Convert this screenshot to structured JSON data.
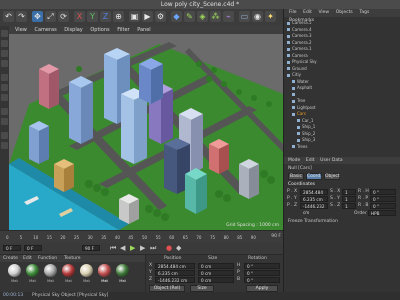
{
  "window": {
    "title": "Low poly city_Scene.c4d *"
  },
  "toolbar": {
    "buttons": [
      "undo-icon",
      "redo-icon",
      "move-icon",
      "scale-icon",
      "rotate-icon",
      "x-axis",
      "y-axis",
      "z-axis",
      "world-icon",
      "render-icon",
      "render-view-icon",
      "render-settings-icon",
      "cube-icon",
      "pen-icon",
      "subdivision-icon",
      "array-icon",
      "deformer-icon",
      "floor-icon",
      "camera-icon",
      "light-icon"
    ],
    "axis_labels": {
      "x": "X",
      "y": "Y",
      "z": "Z"
    }
  },
  "viewport": {
    "menu": [
      "View",
      "Cameras",
      "Display",
      "Options",
      "Filter",
      "Panel"
    ],
    "grid_spacing": "Grid Spacing : 1000 cm"
  },
  "timeline": {
    "ticks": [
      "0",
      "5",
      "10",
      "15",
      "20",
      "25",
      "30",
      "35",
      "40",
      "45",
      "50",
      "55",
      "60",
      "65",
      "70",
      "75",
      "80",
      "85",
      "90"
    ],
    "frame_start": "0 F",
    "frame_end": "90 F",
    "current_frame": "0 F"
  },
  "materials": {
    "menu": [
      "Create",
      "Edit",
      "Function",
      "Texture"
    ],
    "items": [
      {
        "label": "Mat",
        "color": "#cfcfcf"
      },
      {
        "label": "Mat",
        "color": "#3f8d3a"
      },
      {
        "label": "Mat",
        "color": "#a8a8a8"
      },
      {
        "label": "Mat",
        "color": "#b83a3a"
      },
      {
        "label": "Mat",
        "color": "#d8d0b0"
      },
      {
        "label": "Mat",
        "color": "#4a4a4a"
      },
      {
        "label": "Mat",
        "color": "#5b8c30"
      },
      {
        "label": "Mat",
        "color": "#9a9a9a"
      },
      {
        "label": "Mat",
        "color": "#3f7a3a"
      },
      {
        "label": "Mat",
        "color": "#c25050"
      }
    ]
  },
  "coordinates": {
    "headers": [
      "Position",
      "Size",
      "Rotation"
    ],
    "rows": [
      {
        "axis": "X",
        "pos": "2854.484 cm",
        "size": "0 cm",
        "rot_label": "H",
        "rot": "0 °"
      },
      {
        "axis": "Y",
        "pos": "6.235 cm",
        "size": "0 cm",
        "rot_label": "P",
        "rot": "0 °"
      },
      {
        "axis": "Z",
        "pos": "-1446.232 cm",
        "size": "0 cm",
        "rot_label": "B",
        "rot": "0 °"
      }
    ],
    "mode": "Object (Rel)",
    "size_mode": "Size",
    "apply": "Apply"
  },
  "status": {
    "text": "Physical Sky Object [Physical Sky]",
    "time": "00:00:13"
  },
  "object_manager": {
    "tabs": [
      "File",
      "Edit",
      "View",
      "Objects",
      "Tags",
      "Bookmarks"
    ],
    "objects": [
      {
        "name": "Camera.5",
        "selected": false,
        "indent": 0
      },
      {
        "name": "Camera.4",
        "selected": false,
        "indent": 0
      },
      {
        "name": "Camera.3",
        "selected": false,
        "indent": 0
      },
      {
        "name": "Camera.2",
        "selected": false,
        "indent": 0
      },
      {
        "name": "Camera.1",
        "selected": false,
        "indent": 0
      },
      {
        "name": "Camera",
        "selected": false,
        "indent": 0
      },
      {
        "name": "Physical Sky",
        "selected": false,
        "indent": 0
      },
      {
        "name": "Ground",
        "selected": false,
        "indent": 0
      },
      {
        "name": "Citiy",
        "selected": false,
        "indent": 0
      },
      {
        "name": "Water",
        "selected": false,
        "indent": 1
      },
      {
        "name": "Asphalt",
        "selected": false,
        "indent": 1
      },
      {
        "name": "",
        "selected": false,
        "indent": 1
      },
      {
        "name": "Tree",
        "selected": false,
        "indent": 1
      },
      {
        "name": "Lightpost",
        "selected": false,
        "indent": 1
      },
      {
        "name": "Cars",
        "selected": true,
        "indent": 1
      },
      {
        "name": "Car_1",
        "selected": false,
        "indent": 2
      },
      {
        "name": "Ship_1",
        "selected": false,
        "indent": 2
      },
      {
        "name": "Ship_2",
        "selected": false,
        "indent": 2
      },
      {
        "name": "Ship_3",
        "selected": false,
        "indent": 2
      },
      {
        "name": "Trees",
        "selected": false,
        "indent": 1
      }
    ]
  },
  "attributes": {
    "tabs": [
      "Mode",
      "Edit",
      "User Data"
    ],
    "object_title": "Null [Cars]",
    "subtabs": [
      "Basic",
      "Coord.",
      "Object"
    ],
    "section": "Coordinates",
    "rows": [
      {
        "axis": "P . X",
        "value": "2854.484 cm",
        "s_label": "S . X",
        "s_value": "1",
        "r_label": "R . H",
        "r_value": "0 °"
      },
      {
        "axis": "P . Y",
        "value": "6.235 cm",
        "s_label": "S . Y",
        "s_value": "1",
        "r_label": "R . P",
        "r_value": "0 °"
      },
      {
        "axis": "P . Z",
        "value": "-1446.232 cm",
        "s_label": "S . Z",
        "s_value": "1",
        "r_label": "R . B",
        "r_value": "0 °"
      }
    ],
    "order_label": "Order",
    "order_value": "HPB",
    "freeze": "Freeze Transformation"
  },
  "colors": {
    "accent": "#f0a020",
    "water": "#29a9c9",
    "grass": "#3c8a2f",
    "road": "#555555"
  }
}
